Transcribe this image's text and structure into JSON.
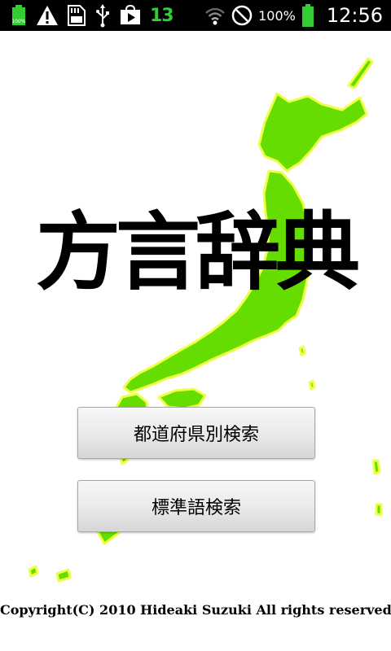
{
  "status_bar": {
    "notification_count": "13",
    "battery_percent": "100%",
    "clock": "12:56",
    "left_icons": [
      "battery-small-icon",
      "warning-icon",
      "sd-card-icon",
      "usb-icon",
      "play-store-icon"
    ],
    "right_icons": [
      "wifi-icon",
      "no-signal-icon",
      "battery-icon"
    ]
  },
  "app": {
    "title": "方言辞典",
    "buttons": {
      "prefecture_search": "都道府県別検索",
      "standard_word_search": "標準語検索"
    },
    "copyright": "Copyright(C) 2010 Hideaki Suzuki All rights reserved."
  },
  "colors": {
    "map_fill": "#66dd00",
    "map_outline": "#eeff44",
    "status_bar_bg": "#000000",
    "notification_green": "#33cc33"
  }
}
